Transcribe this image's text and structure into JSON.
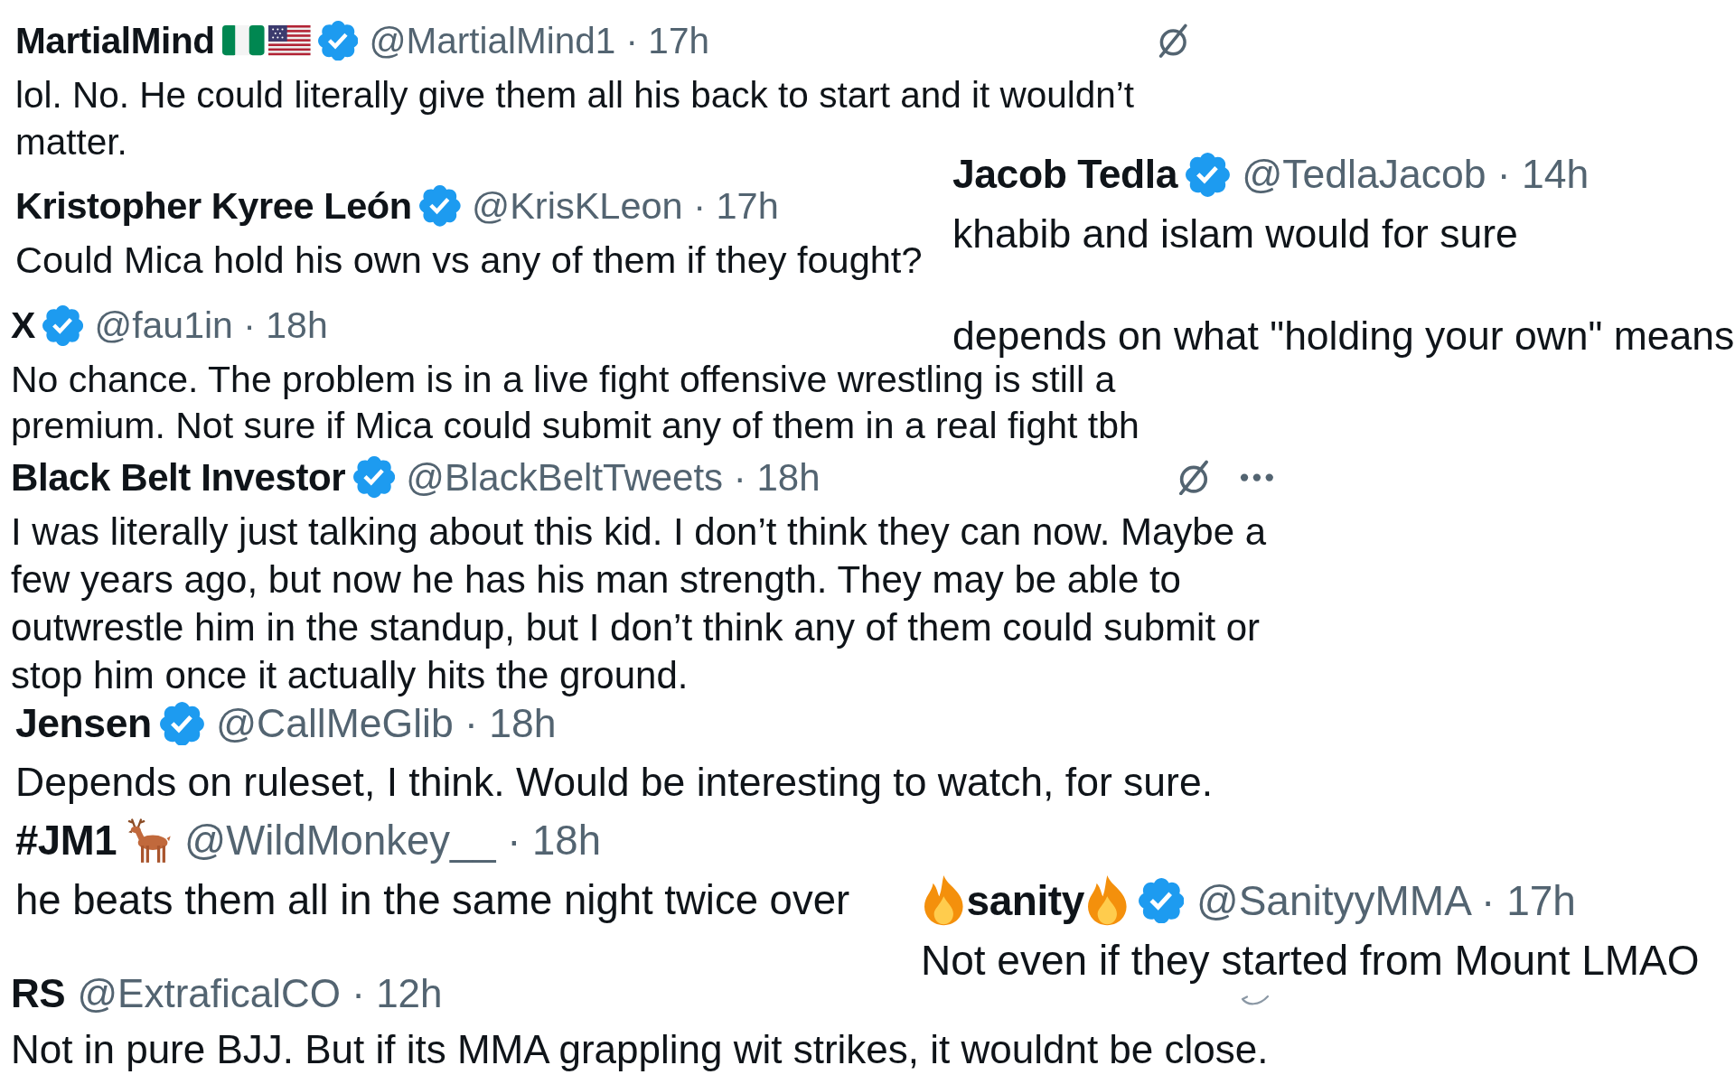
{
  "posts": [
    {
      "name": "MartialMind",
      "icons_after": [
        {
          "kind": "nigeria-flag"
        },
        {
          "kind": "us-flag"
        }
      ],
      "verified": true,
      "meta": "@MartialMind1 · 17h",
      "actions": [
        {
          "kind": "slash-circle"
        }
      ],
      "paragraphs": [
        "lol. No. He could literally give them all his back to start and it wouldn’t matter."
      ]
    },
    {
      "name": "Kristopher Kyree León",
      "verified": true,
      "meta": "@KrisKLeon · 17h",
      "paragraphs": [
        "Could Mica hold his own vs any of them if they fought?"
      ]
    },
    {
      "name": "Jacob Tedla",
      "verified": true,
      "meta": "@TedlaJacob · 14h",
      "paragraphs": [
        "khabib and islam would for sure",
        "depends on what \"holding your own\" means"
      ]
    },
    {
      "name": "X",
      "verified": true,
      "meta": "@fau1in · 18h",
      "paragraphs": [
        "No chance. The problem is in a live fight offensive wrestling is still a premium. Not sure if Mica could submit any of them in a real fight tbh"
      ]
    },
    {
      "name": "Black Belt Investor",
      "verified": true,
      "meta": "@BlackBeltTweets · 18h",
      "actions": [
        {
          "kind": "slash-circle"
        },
        {
          "kind": "more"
        }
      ],
      "paragraphs": [
        "I was literally just talking about this kid. I don’t think they can now. Maybe a few years ago, but now he has his man strength. They may be able to outwrestle him in the standup, but I don’t think any of them could submit or stop him once it actually hits the ground."
      ]
    },
    {
      "name": "Jensen",
      "verified": true,
      "meta": "@CallMeGlib · 18h",
      "paragraphs": [
        "Depends on ruleset, I think. Would be interesting to watch, for sure."
      ]
    },
    {
      "name": "#JM1",
      "icons_after": [
        {
          "kind": "deer"
        }
      ],
      "verified": false,
      "meta": "@WildMonkey__ · 18h",
      "paragraphs": [
        "he beats them all in the same night twice over"
      ]
    },
    {
      "name": "sanity",
      "icons_before": [
        {
          "kind": "fire"
        }
      ],
      "icons_after": [
        {
          "kind": "fire"
        }
      ],
      "verified": true,
      "meta": "@SanityyMMA · 17h",
      "paragraphs": [
        "Not even if they started from Mount LMAO"
      ]
    },
    {
      "name": "RS",
      "verified": false,
      "meta": "@ExtraficalCO · 12h",
      "paragraphs": [
        "Not in pure BJJ. But if its MMA grappling wit strikes, it wouldnt be close."
      ]
    }
  ]
}
